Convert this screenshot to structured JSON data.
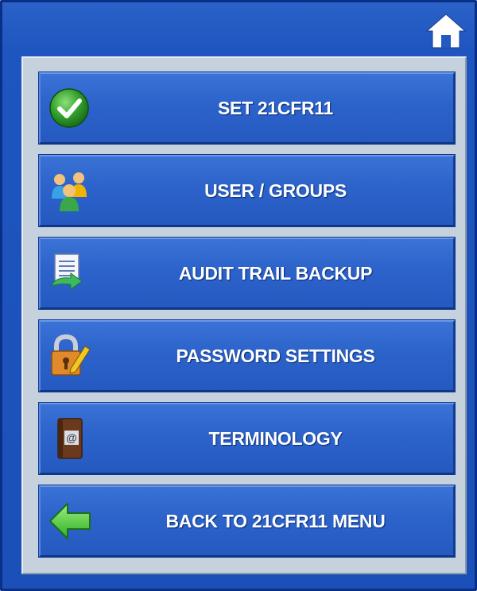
{
  "window": {
    "home_icon": "home-icon"
  },
  "menu": {
    "items": [
      {
        "label": "SET 21CFR11",
        "icon": "check-circle-icon"
      },
      {
        "label": "USER / GROUPS",
        "icon": "users-group-icon"
      },
      {
        "label": "AUDIT TRAIL BACKUP",
        "icon": "document-backup-icon"
      },
      {
        "label": "PASSWORD SETTINGS",
        "icon": "padlock-edit-icon"
      },
      {
        "label": "TERMINOLOGY",
        "icon": "address-book-icon"
      },
      {
        "label": "BACK TO 21CFR11 MENU",
        "icon": "back-arrow-icon"
      }
    ]
  },
  "colors": {
    "frame_blue": "#1f55bf",
    "button_blue": "#2c63ca",
    "panel_gray": "#c6d1de",
    "label_white": "#ffffff"
  }
}
